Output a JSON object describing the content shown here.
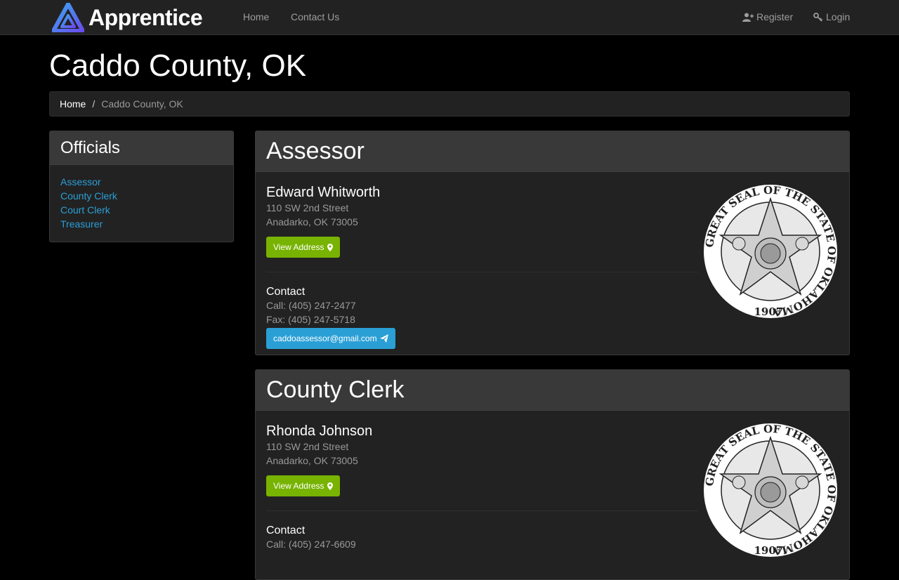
{
  "navbar": {
    "brand": "Apprentice",
    "links": [
      "Home",
      "Contact Us"
    ],
    "register": "Register",
    "login": "Login"
  },
  "page": {
    "title": "Caddo County, OK"
  },
  "breadcrumb": {
    "home": "Home",
    "separator": "/",
    "current": "Caddo County, OK"
  },
  "sidebar": {
    "title": "Officials",
    "items": [
      "Assessor",
      "County Clerk",
      "Court Clerk",
      "Treasurer"
    ]
  },
  "officials": [
    {
      "office": "Assessor",
      "name": "Edward Whitworth",
      "address1": "110 SW 2nd Street",
      "address2": "Anadarko, OK 73005",
      "view_address_label": "View Address",
      "contact_heading": "Contact",
      "call": "Call: (405) 247-2477",
      "fax": "Fax: (405) 247-5718",
      "email": "caddoassessor@gmail.com"
    },
    {
      "office": "County Clerk",
      "name": "Rhonda Johnson",
      "address1": "110 SW 2nd Street",
      "address2": "Anadarko, OK 73005",
      "view_address_label": "View Address",
      "contact_heading": "Contact",
      "call": "Call: (405) 247-6609"
    }
  ],
  "seal": {
    "text": "GREAT SEAL OF THE STATE OF OKLAHOMA",
    "year": "1907."
  },
  "colors": {
    "link": "#2a9fd6",
    "success": "#77b300",
    "info": "#2a9fd6",
    "panel": "#222222",
    "panel_head": "#393939"
  }
}
